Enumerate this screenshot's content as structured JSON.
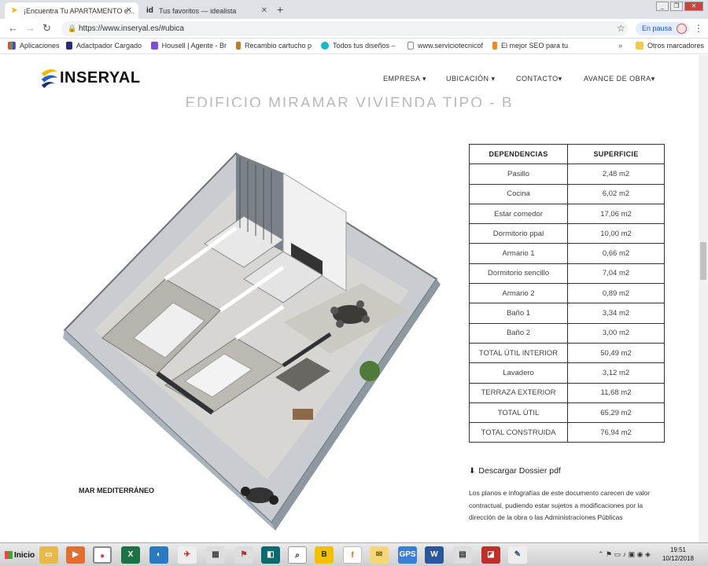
{
  "tabs": [
    {
      "icon": "inseryal-favicon-icon",
      "label": "¡Encuentra Tu APARTAMENTO e..."
    },
    {
      "icon": "idealista-favicon-icon",
      "label": "Tus favoritos — idealista"
    }
  ],
  "url": "https://www.inseryal.es/#ubica",
  "profile_pill": "En pausa",
  "bookmarks": [
    "Aplicaciones",
    "Adactpador Cargado",
    "Housell | Agente - Br",
    "Recambio cartucho p",
    "Todos tus diseños – ",
    "www.serviciotecnicof",
    "El mejor SEO para tu",
    "Otros marcadores"
  ],
  "site": {
    "logo_text": "INSERYAL",
    "nav": [
      "EMPRESA",
      "UBICACIÓN",
      "CONTACTO",
      "AVANCE DE OBRA"
    ],
    "title": "EDIFICIO MIRAMAR VIVIENDA TIPO - B"
  },
  "plan_caption": "MAR MEDITERRÁNEO",
  "table": {
    "headers": [
      "DEPENDENCIAS",
      "SUPERFICIE"
    ],
    "rows": [
      [
        "Pasillo",
        "2,48 m2"
      ],
      [
        "Cocina",
        "6,02 m2"
      ],
      [
        "Estar comedor",
        "17,06 m2"
      ],
      [
        "Dormitorio ppal",
        "10,00 m2"
      ],
      [
        "Armario 1",
        "0,66 m2"
      ],
      [
        "Dormitorio sencillo",
        "7,04 m2"
      ],
      [
        "Armario 2",
        "0,89 m2"
      ],
      [
        "Baño 1",
        "3,34 m2"
      ],
      [
        "Baño 2",
        "3,00 m2"
      ],
      [
        "TOTAL ÚTIL INTERIOR",
        "50,49 m2"
      ],
      [
        "Lavadero",
        "3,12 m2"
      ],
      [
        "TERRAZA EXTERIOR",
        "11,68 m2"
      ],
      [
        "TOTAL ÚTIL",
        "65,29 m2"
      ],
      [
        "TOTAL CONSTRUIDA",
        "76,94 m2"
      ]
    ]
  },
  "dossier_label": "Descargar Dossier pdf",
  "disclaimer": "Los planos e infografías de este documento carecen de valor contractual, pudiendo estar sujetos a modificaciones por la dirección de la obra o las Administraciones Públicas",
  "taskbar": {
    "start_label": "Inicio",
    "clock_time": "19:51",
    "clock_date": "10/12/2018"
  },
  "colors": {
    "accent_blue": "#1a56c4",
    "logo_yellow": "#f2b705",
    "logo_blue": "#2b5fb0"
  }
}
